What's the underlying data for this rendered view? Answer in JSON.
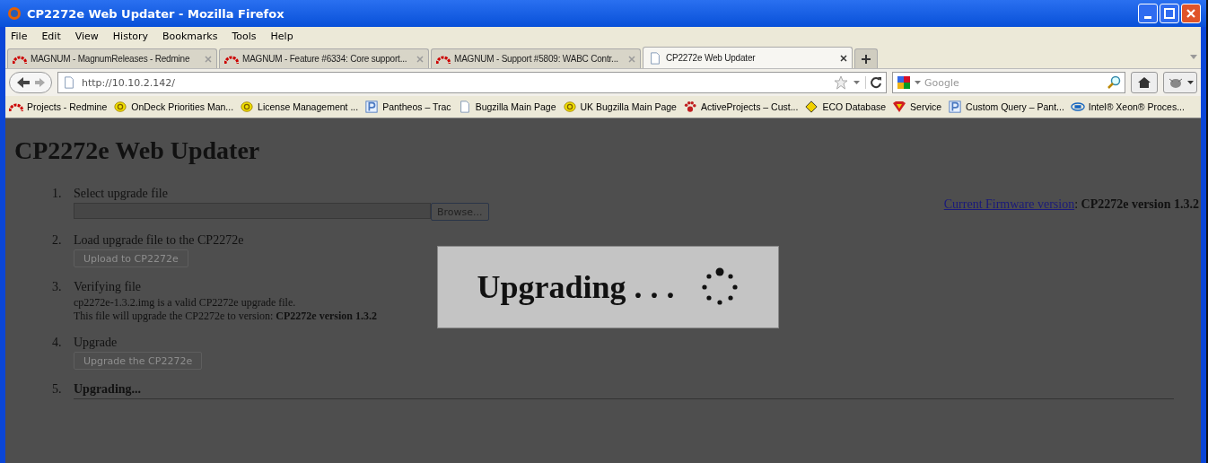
{
  "window": {
    "title": "CP2272e Web Updater - Mozilla Firefox"
  },
  "menu": [
    "File",
    "Edit",
    "View",
    "History",
    "Bookmarks",
    "Tools",
    "Help"
  ],
  "tabs": [
    {
      "label": "MAGNUM - MagnumReleases - Redmine",
      "kind": "redmine",
      "selected": false
    },
    {
      "label": "MAGNUM - Feature #6334: Core support...",
      "kind": "redmine",
      "selected": false
    },
    {
      "label": "MAGNUM - Support #5809: WABC Contr...",
      "kind": "redmine",
      "selected": false
    },
    {
      "label": "CP2272e Web Updater",
      "kind": "page",
      "selected": true
    }
  ],
  "address": {
    "value": "http://10.10.2.142/"
  },
  "search": {
    "placeholder": "Google"
  },
  "bookmarks": [
    {
      "label": "Projects - Redmine",
      "kind": "redmine"
    },
    {
      "label": "OnDeck Priorities Man...",
      "kind": "ie"
    },
    {
      "label": "License Management ...",
      "kind": "ie"
    },
    {
      "label": "Pantheos – Trac",
      "kind": "p"
    },
    {
      "label": "Bugzilla Main Page",
      "kind": "page"
    },
    {
      "label": "UK Bugzilla Main Page",
      "kind": "ie"
    },
    {
      "label": "ActiveProjects – Cust...",
      "kind": "paw"
    },
    {
      "label": "ECO Database",
      "kind": "diamond"
    },
    {
      "label": "Service",
      "kind": "shield"
    },
    {
      "label": "Custom Query – Pant...",
      "kind": "p"
    },
    {
      "label": "Intel® Xeon® Proces...",
      "kind": "intel"
    }
  ],
  "page": {
    "title": "CP2272e Web Updater",
    "firmware": {
      "link": "Current Firmware version",
      "value": ": **CP2272e version 1.3.2**"
    },
    "steps": [
      {
        "number": "1.",
        "label": "Select upgrade file",
        "kind": "file",
        "button": "Browse..."
      },
      {
        "number": "2.",
        "label": "Load upgrade file to the CP2272e",
        "kind": "button",
        "button": "Upload to CP2272e",
        "disabled": true
      },
      {
        "number": "3.",
        "label": "Verifying file",
        "kind": "text",
        "lines": [
          "cp2272e-1.3.2.img is a valid CP2272e upgrade file.",
          "This file will upgrade the CP2272e to version: **CP2272e version 1.3.2**"
        ]
      },
      {
        "number": "4.",
        "label": "Upgrade",
        "kind": "button",
        "button": "Upgrade the CP2272e",
        "disabled": true
      },
      {
        "number": "5.",
        "label": "Upgrading...",
        "kind": "current"
      }
    ]
  },
  "dialog": {
    "text": "Upgrading . . ."
  }
}
